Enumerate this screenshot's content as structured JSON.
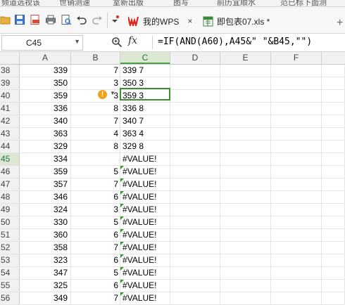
{
  "top_strip": [
    "频道选视该",
    "世销测速",
    "室新出版",
    "图写",
    "前历宜顺水",
    "范已标下面测"
  ],
  "tabs": [
    {
      "label": "我的WPS",
      "icon": "wps-logo-icon",
      "close": "×"
    },
    {
      "label": "即包表07.xls *",
      "icon": "spreadsheet-file-icon",
      "close": "×"
    }
  ],
  "new_tab": "+",
  "formula_bar": {
    "name_box": "C45",
    "fx": "fx",
    "formula": "=IF(AND(A60),A45&\" \"&B45,\"\")"
  },
  "columns": [
    "A",
    "B",
    "C",
    "D",
    "E",
    "F"
  ],
  "selected_cell": "C45",
  "rows": [
    {
      "n": "38",
      "a": "339",
      "b": "7",
      "c": "339 7"
    },
    {
      "n": "39",
      "a": "350",
      "b": "3",
      "c": "350 3"
    },
    {
      "n": "40",
      "a": "359",
      "b": "3",
      "c": "359 3"
    },
    {
      "n": "41",
      "a": "336",
      "b": "8",
      "c": "336 8"
    },
    {
      "n": "42",
      "a": "340",
      "b": "7",
      "c": "340 7"
    },
    {
      "n": "43",
      "a": "363",
      "b": "4",
      "c": "363 4"
    },
    {
      "n": "44",
      "a": "329",
      "b": "8",
      "c": "329 8"
    },
    {
      "n": "45",
      "a": "334",
      "b": "",
      "c": "#VALUE!"
    },
    {
      "n": "46",
      "a": "359",
      "b": "5",
      "c": "#VALUE!"
    },
    {
      "n": "47",
      "a": "357",
      "b": "7",
      "c": "#VALUE!"
    },
    {
      "n": "48",
      "a": "346",
      "b": "6",
      "c": "#VALUE!"
    },
    {
      "n": "49",
      "a": "324",
      "b": "3",
      "c": "#VALUE!"
    },
    {
      "n": "50",
      "a": "330",
      "b": "5",
      "c": "#VALUE!"
    },
    {
      "n": "51",
      "a": "360",
      "b": "6",
      "c": "#VALUE!"
    },
    {
      "n": "52",
      "a": "358",
      "b": "7",
      "c": "#VALUE!"
    },
    {
      "n": "53",
      "a": "323",
      "b": "6",
      "c": "#VALUE!"
    },
    {
      "n": "54",
      "a": "347",
      "b": "5",
      "c": "#VALUE!"
    },
    {
      "n": "55",
      "a": "325",
      "b": "6",
      "c": "#VALUE!"
    },
    {
      "n": "56",
      "a": "349",
      "b": "7",
      "c": "#VALUE!"
    }
  ],
  "error_indicator": "!",
  "colors": {
    "accent": "#217346",
    "selection": "#3e8e2e",
    "warning": "#f0a21d",
    "wps_red": "#d7261c"
  }
}
